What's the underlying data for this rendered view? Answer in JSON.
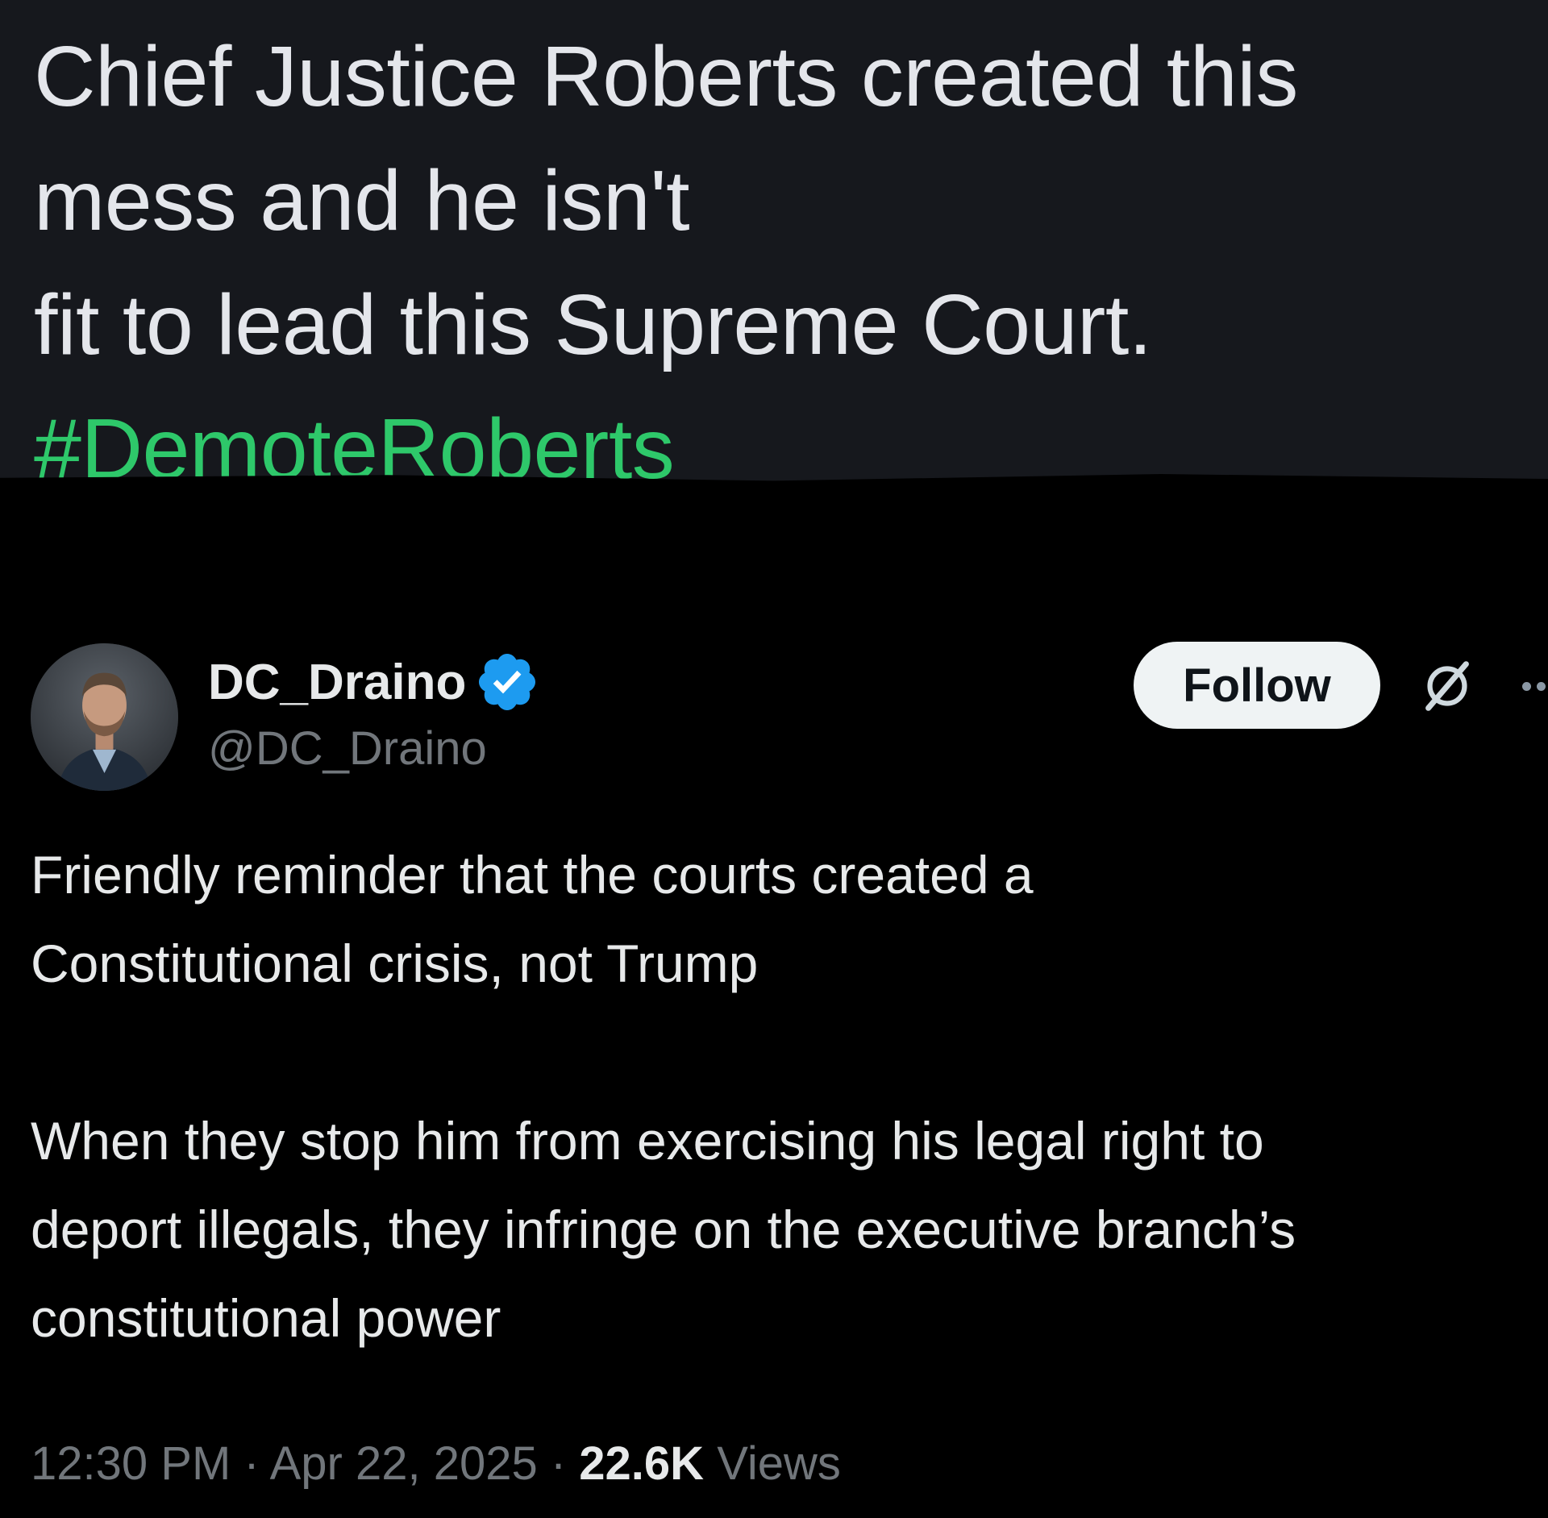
{
  "top_post": {
    "lines": [
      "Chief Justice Roberts created this",
      "mess and he isn't",
      "fit to lead this Supreme Court."
    ],
    "hashtag": "#DemoteRoberts"
  },
  "tweet": {
    "display_name": "DC_Draino",
    "handle": "@DC_Draino",
    "follow_label": "Follow",
    "body_lines_1": [
      "Friendly reminder that the courts created a",
      "Constitutional crisis, not Trump"
    ],
    "body_lines_2": [
      "When they stop him from exercising his legal right to",
      "deport illegals, they infringe on the executive branch’s",
      "constitutional power"
    ],
    "meta": {
      "time": "12:30 PM",
      "separator": " · ",
      "date": "Apr 22, 2025",
      "views_count": "22.6K",
      "views_label": "Views"
    },
    "icons": {
      "verified": "verified-badge-icon",
      "grok": "grok-icon",
      "more": "more-icon"
    }
  },
  "colors": {
    "top_background": "#16181d",
    "tweet_background": "#000000",
    "hashtag": "#2ec86a",
    "verified_blue": "#1d9bf0",
    "secondary_text": "#71767b"
  }
}
